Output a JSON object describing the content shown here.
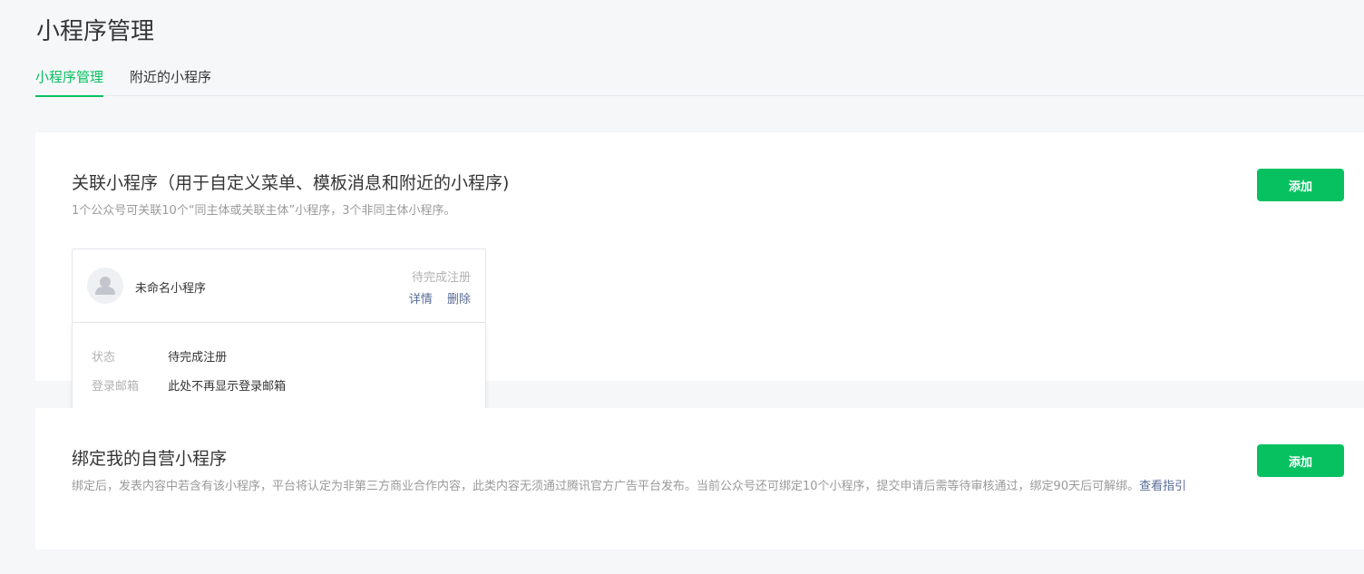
{
  "page": {
    "title": "小程序管理"
  },
  "tabs": [
    {
      "label": "小程序管理",
      "active": true
    },
    {
      "label": "附近的小程序",
      "active": false
    }
  ],
  "linked_section": {
    "title": "关联小程序（用于自定义菜单、模板消息和附近的小程序)",
    "description": "1个公众号可关联10个“同主体或关联主体”小程序，3个非同主体小程序。",
    "add_label": "添加",
    "item": {
      "name": "未命名小程序",
      "status": "待完成注册",
      "actions": [
        "详情",
        "删除"
      ]
    },
    "detail": {
      "rows": [
        {
          "key": "状态",
          "value": "待完成注册"
        },
        {
          "key": "登录邮箱",
          "value": "此处不再显示登录邮箱"
        }
      ]
    }
  },
  "bind_section": {
    "title": "绑定我的自营小程序",
    "description": "绑定后，发表内容中若含有该小程序，平台将认定为非第三方商业合作内容，此类内容无须通过腾讯官方广告平台发布。当前公众号还可绑定10个小程序，提交申请后需等待审核通过，绑定90天后可解绑。",
    "guide_link": "查看指引",
    "add_label": "添加"
  },
  "colors": {
    "accent": "#07c160",
    "link": "#576b95"
  }
}
